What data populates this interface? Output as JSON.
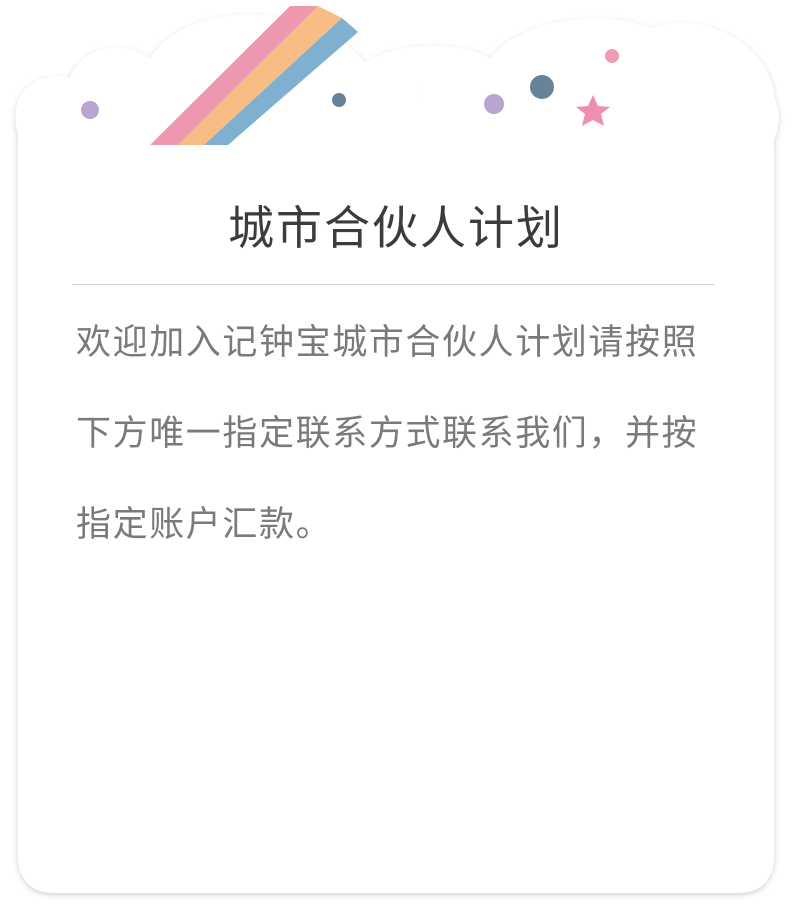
{
  "dialog": {
    "title": "城市合伙人计划",
    "message": "欢迎加入记钟宝城市合伙人计划请按照下方唯一指定联系方式联系我们，并按指定账户汇款。"
  },
  "decoration": {
    "icons": [
      "rainbow-icon",
      "moon-icon",
      "star-icon",
      "dot-icon",
      "cloud-shape"
    ]
  },
  "colors": {
    "rainbow_pink": "#ee98b0",
    "rainbow_orange": "#f7bd85",
    "rainbow_blue": "#7fb0cf",
    "moon_green": "#3dc48d",
    "star_pink": "#ee8fae",
    "dot_purple": "#b9a4d2",
    "dot_slate": "#67839a",
    "dot_pink": "#f09ab3",
    "title_text": "#3c3c3c",
    "body_text": "#7a7a7a",
    "divider": "#cfcfcf"
  }
}
